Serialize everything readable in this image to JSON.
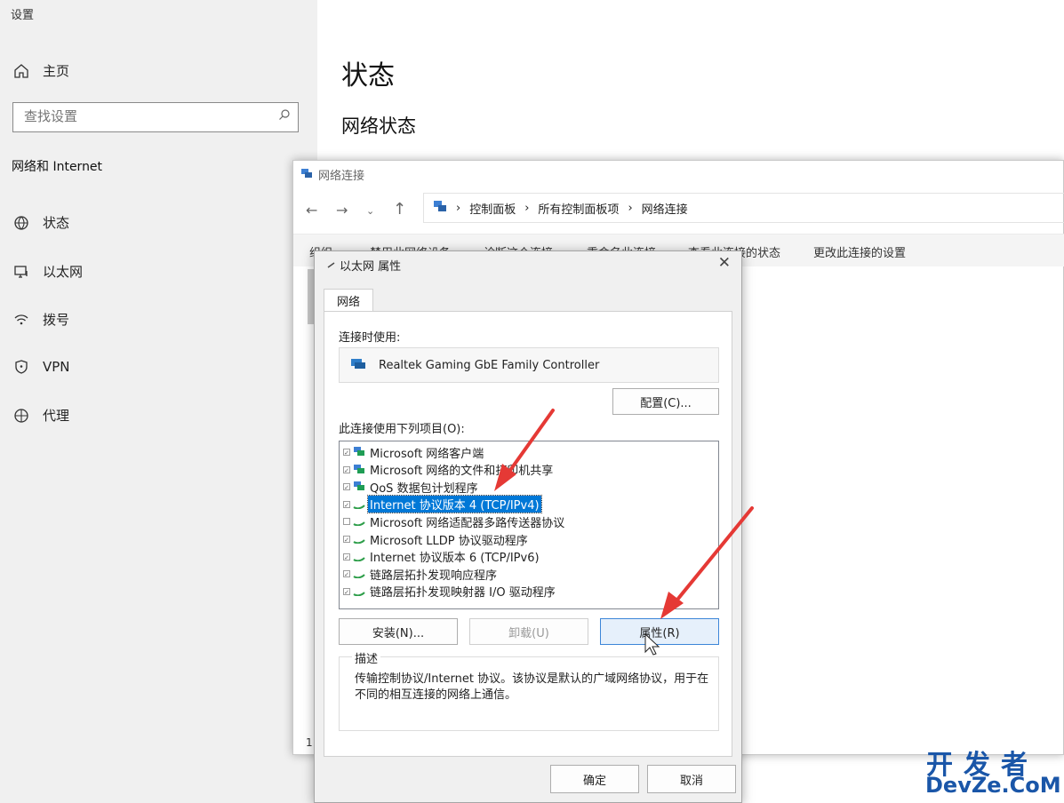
{
  "settings": {
    "app_title": "设置",
    "home_label": "主页",
    "search_placeholder": "查找设置",
    "section_label": "网络和 Internet",
    "nav": [
      {
        "label": "状态",
        "icon": "globe-status-icon"
      },
      {
        "label": "以太网",
        "icon": "ethernet-icon"
      },
      {
        "label": "拨号",
        "icon": "dialup-icon"
      },
      {
        "label": "VPN",
        "icon": "vpn-shield-icon"
      },
      {
        "label": "代理",
        "icon": "proxy-globe-icon"
      }
    ],
    "main_title": "状态",
    "main_subtitle": "网络状态"
  },
  "network_connections": {
    "title": "网络连接",
    "breadcrumb": [
      "控制面板",
      "所有控制面板项",
      "网络连接"
    ],
    "toolbar": [
      "组织 ▾",
      "禁用此网络设备",
      "诊断这个连接",
      "重命名此连接",
      "查看此连接的状态",
      "更改此连接的设置"
    ],
    "status_count": "1"
  },
  "dialog": {
    "title": "以太网 属性",
    "tab": "网络",
    "connect_using_label": "连接时使用:",
    "adapter_name": "Realtek Gaming GbE Family Controller",
    "configure_button": "配置(C)...",
    "items_label": "此连接使用下列项目(O):",
    "items": [
      {
        "label": "Microsoft 网络客户端",
        "checked": true,
        "selected": false
      },
      {
        "label": "Microsoft 网络的文件和打印机共享",
        "checked": true,
        "selected": false
      },
      {
        "label": "QoS 数据包计划程序",
        "checked": true,
        "selected": false
      },
      {
        "label": "Internet 协议版本 4 (TCP/IPv4)",
        "checked": true,
        "selected": true
      },
      {
        "label": "Microsoft 网络适配器多路传送器协议",
        "checked": false,
        "selected": false
      },
      {
        "label": "Microsoft LLDP 协议驱动程序",
        "checked": true,
        "selected": false
      },
      {
        "label": "Internet 协议版本 6 (TCP/IPv6)",
        "checked": true,
        "selected": false
      },
      {
        "label": "链路层拓扑发现响应程序",
        "checked": true,
        "selected": false
      },
      {
        "label": "链路层拓扑发现映射器 I/O 驱动程序",
        "checked": true,
        "selected": false
      }
    ],
    "install_button": "安装(N)...",
    "uninstall_button": "卸载(U)",
    "properties_button": "属性(R)",
    "description_caption": "描述",
    "description_text": "传输控制协议/Internet 协议。该协议是默认的广域网络协议，用于在不同的相互连接的网络上通信。",
    "ok_button": "确定",
    "cancel_button": "取消"
  },
  "watermark": {
    "top": "开发者",
    "bottom": "DevZe.CoM"
  },
  "colors": {
    "accent": "#0078d7",
    "arrow": "#e53935",
    "watermark": "#1a56a8"
  }
}
